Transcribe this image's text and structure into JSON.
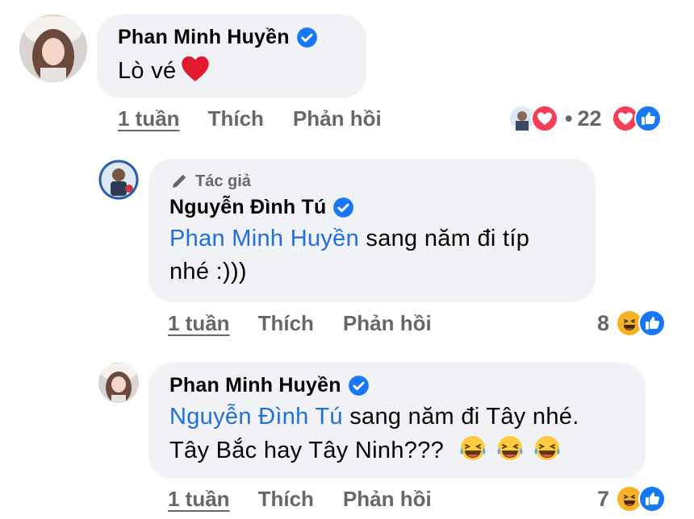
{
  "comments": [
    {
      "author": "Phan Minh Huyền",
      "text": "Lò vé",
      "time": "1 tuần",
      "like": "Thích",
      "reply": "Phản hồi",
      "reaction_count": "22",
      "reaction_separator": "•"
    },
    {
      "badge": "Tác giả",
      "author": "Nguyễn Đình Tú",
      "mention": "Phan Minh Huyền",
      "text_line1": " sang năm đi típ",
      "text_line2": "nhé :)))",
      "time": "1 tuần",
      "like": "Thích",
      "reply": "Phản hồi",
      "reaction_count": "8"
    },
    {
      "author": "Phan Minh Huyền",
      "mention": "Nguyễn Đình Tú",
      "text_line1": " sang năm đi Tây nhé.",
      "text_line2": "Tây Bắc hay Tây Ninh???",
      "time": "1 tuần",
      "like": "Thích",
      "reply": "Phản hồi",
      "reaction_count": "7"
    }
  ],
  "colors": {
    "bubble": "#f0f2f5",
    "mention": "#216fdb",
    "meta": "#65676b",
    "verified": "#1877f2",
    "love": "#f33e58",
    "like": "#1877f2",
    "haha": "#f7b125"
  },
  "icons": [
    "verified-badge-icon",
    "heart-emoji-icon",
    "love-reaction-icon",
    "like-reaction-icon",
    "haha-reaction-icon",
    "pencil-icon",
    "tears-of-joy-emoji-icon"
  ]
}
